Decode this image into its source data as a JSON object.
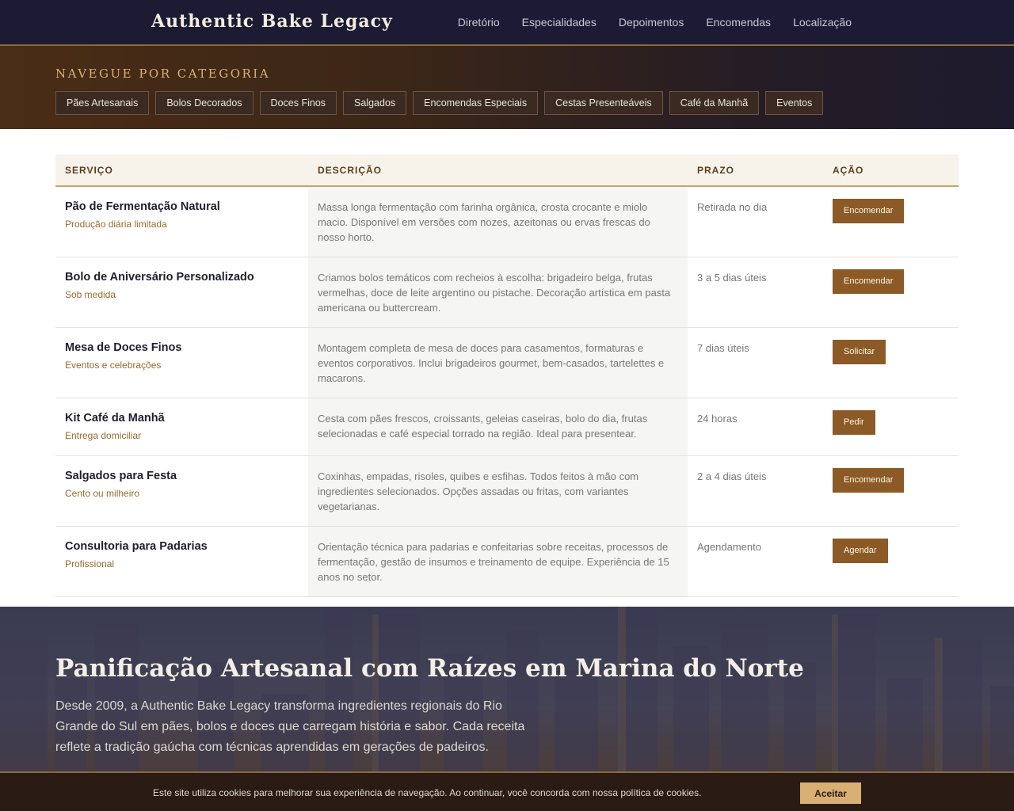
{
  "header": {
    "brand": "Authentic Bake Legacy",
    "nav": [
      "Diretório",
      "Especialidades",
      "Depoimentos",
      "Encomendas",
      "Localização"
    ]
  },
  "categories": {
    "title": "NAVEGUE POR CATEGORIA",
    "items": [
      "Pães Artesanais",
      "Bolos Decorados",
      "Doces Finos",
      "Salgados",
      "Encomendas Especiais",
      "Cestas Presenteáveis",
      "Café da Manhã",
      "Eventos"
    ]
  },
  "table": {
    "headers": [
      "SERVIÇO",
      "DESCRIÇÃO",
      "PRAZO",
      "AÇÃO"
    ],
    "rows": [
      {
        "name": "Pão de Fermentação Natural",
        "sub": "Produção diária limitada",
        "desc": "Massa longa fermentação com farinha orgânica, crosta crocante e miolo macio. Disponível em versões com nozes, azeitonas ou ervas frescas do nosso horto.",
        "prazo": "Retirada no dia",
        "action": "Encomendar"
      },
      {
        "name": "Bolo de Aniversário Personalizado",
        "sub": "Sob medida",
        "desc": "Criamos bolos temáticos com recheios à escolha: brigadeiro belga, frutas vermelhas, doce de leite argentino ou pistache. Decoração artística em pasta americana ou buttercream.",
        "prazo": "3 a 5 dias úteis",
        "action": "Encomendar"
      },
      {
        "name": "Mesa de Doces Finos",
        "sub": "Eventos e celebrações",
        "desc": "Montagem completa de mesa de doces para casamentos, formaturas e eventos corporativos. Inclui brigadeiros gourmet, bem-casados, tartelettes e macarons.",
        "prazo": "7 dias úteis",
        "action": "Solicitar"
      },
      {
        "name": "Kit Café da Manhã",
        "sub": "Entrega domiciliar",
        "desc": "Cesta com pães frescos, croissants, geleias caseiras, bolo do dia, frutas selecionadas e café especial torrado na região. Ideal para presentear.",
        "prazo": "24 horas",
        "action": "Pedir"
      },
      {
        "name": "Salgados para Festa",
        "sub": "Cento ou milheiro",
        "desc": "Coxinhas, empadas, risoles, quibes e esfihas. Todos feitos à mão com ingredientes selecionados. Opções assadas ou fritas, com variantes vegetarianas.",
        "prazo": "2 a 4 dias úteis",
        "action": "Encomendar"
      },
      {
        "name": "Consultoria para Padarias",
        "sub": "Profissional",
        "desc": "Orientação técnica para padarias e confeitarias sobre receitas, processos de fermentação, gestão de insumos e treinamento de equipe. Experiência de 15 anos no setor.",
        "prazo": "Agendamento",
        "action": "Agendar"
      }
    ]
  },
  "hero": {
    "title": "Panificação Artesanal com Raízes em Marina do Norte",
    "text": "Desde 2009, a Authentic Bake Legacy transforma ingredientes regionais do Rio Grande do Sul em pães, bolos e doces que carregam história e sabor. Cada receita reflete a tradição gaúcha com técnicas aprendidas em gerações de padeiros."
  },
  "cookie": {
    "text": "Este site utiliza cookies para melhorar sua experiência de navegação. Ao continuar, você concorda com nossa política de cookies.",
    "button": "Aceitar"
  },
  "colors": {
    "header_bg": "#1c1b33",
    "accent_gold": "#c9a36a",
    "action_brown": "#8c5a26",
    "cookie_btn": "#d8b074"
  }
}
